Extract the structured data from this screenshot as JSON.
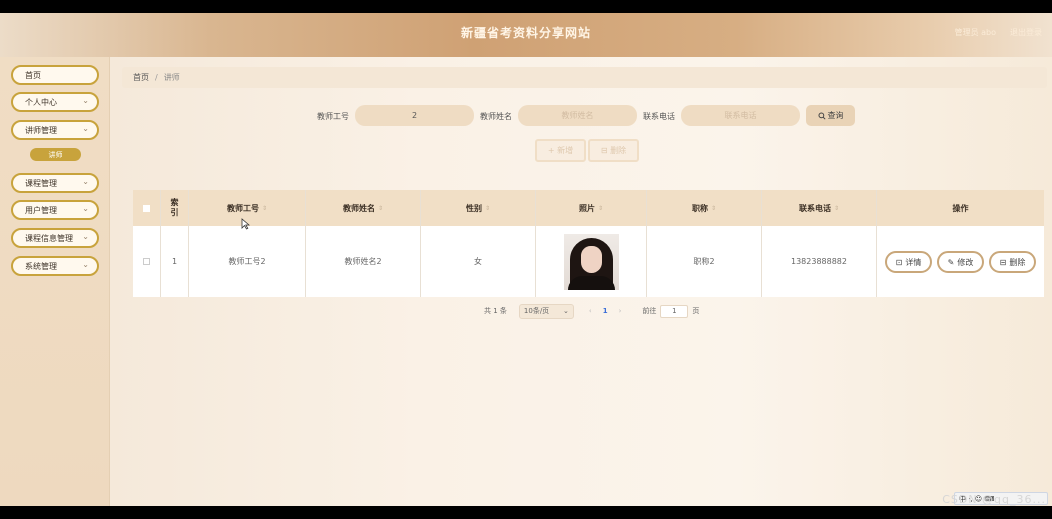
{
  "header": {
    "title": "新疆省考资料分享网站",
    "user_label": "管理员 abo",
    "logout_label": "退出登录"
  },
  "sidebar": {
    "items": [
      {
        "label": "首页",
        "has_chevron": false
      },
      {
        "label": "个人中心",
        "has_chevron": true
      },
      {
        "label": "讲师管理",
        "has_chevron": true
      },
      {
        "label": "课程管理",
        "has_chevron": true
      },
      {
        "label": "用户管理",
        "has_chevron": true
      },
      {
        "label": "课程信息管理",
        "has_chevron": true
      },
      {
        "label": "系统管理",
        "has_chevron": true
      }
    ],
    "active_sub": "讲师",
    "chevron": "⌄"
  },
  "breadcrumb": {
    "home": "首页",
    "separator": "/",
    "current": "讲师"
  },
  "search": {
    "teacher_id_label": "教师工号",
    "teacher_id_value": "2",
    "teacher_name_label": "教师姓名",
    "teacher_name_placeholder": "教师姓名",
    "phone_label": "联系电话",
    "phone_placeholder": "联系电话",
    "search_button": "查询"
  },
  "actions": {
    "add": "+ 新增",
    "delete": "⊟ 删除"
  },
  "table": {
    "headers": {
      "index": "索引",
      "teacher_id": "教师工号",
      "teacher_name": "教师姓名",
      "gender": "性别",
      "photo": "照片",
      "title": "职称",
      "phone": "联系电话",
      "operation": "操作"
    },
    "sort_glyph": "⇕",
    "rows": [
      {
        "index": "1",
        "teacher_id": "教师工号2",
        "teacher_name": "教师姓名2",
        "gender": "女",
        "title": "职称2",
        "phone": "13823888882",
        "ops": {
          "detail": "详情",
          "edit": "修改",
          "delete": "删除"
        }
      }
    ]
  },
  "pager": {
    "total": "共 1 条",
    "page_size": "10条/页",
    "prev": "‹",
    "current": "1",
    "next": "›",
    "goto_label": "前往",
    "goto_value": "1",
    "page_suffix": "页"
  },
  "overlay": {
    "watermark": "CSDN @qq_36...",
    "ime_text": "中 ·, ☺ ⌨"
  },
  "colors": {
    "accent_gold": "#c8a33c",
    "header_brown": "#cfa174",
    "table_header_bg": "#f1dfc6"
  }
}
